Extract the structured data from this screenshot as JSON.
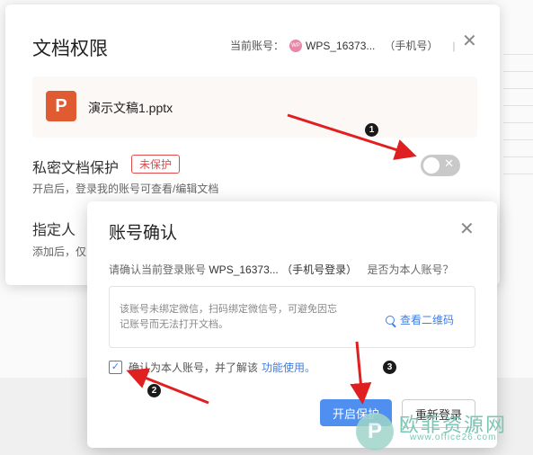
{
  "permission_dialog": {
    "title": "文档权限",
    "account_label": "当前账号：",
    "account_avatar": "WP",
    "account_name": "WPS_16373...",
    "account_type": "（手机号）",
    "separator": "|",
    "file_icon_letter": "P",
    "file_name": "演示文稿1.pptx",
    "private_protection": {
      "label": "私密文档保护",
      "status_badge": "未保护",
      "description": "开启后，登录我的账号可查看/编辑文档",
      "toggle_on": false,
      "toggle_glyph": "✕"
    },
    "assignee": {
      "label": "指定人",
      "description": "添加后，仅"
    },
    "close_glyph": "✕"
  },
  "confirm_dialog": {
    "title": "账号确认",
    "prompt_prefix": "请确认当前登录账号",
    "account_name": "WPS_16373...",
    "account_login_type": "（手机号登录）",
    "prompt_suffix": "是否为本人账号？",
    "info_text": "该账号未绑定微信，扫码绑定微信号，可避免因忘记账号而无法打开文档。",
    "qr_link": "查看二维码",
    "checkbox_checked": true,
    "checkbox_mark": "✓",
    "checkbox_label": "确认为本人账号，并了解该",
    "checkbox_link": "功能使用。",
    "primary_button": "开启保护",
    "secondary_button": "重新登录",
    "close_glyph": "✕"
  },
  "annotations": [
    "1",
    "2",
    "3"
  ],
  "watermark": {
    "logo_letter": "P",
    "text": "欧菲资源网",
    "url": "www.office26.com"
  },
  "colors": {
    "accent": "#3d7ee8",
    "primary_button": "#4f8fef",
    "danger": "#e04b4b",
    "ppt_icon": "#e05a32",
    "arrow": "#e02020"
  }
}
